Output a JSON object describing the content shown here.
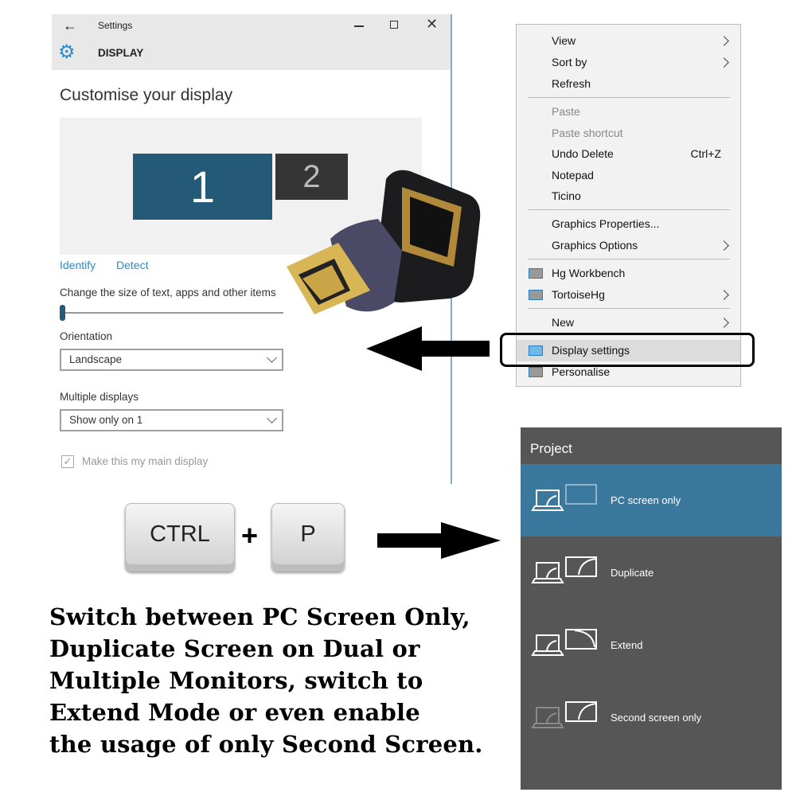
{
  "settings": {
    "window_title": "Settings",
    "section": "DISPLAY",
    "page_title": "Customise your display",
    "monitors": [
      "1",
      "2"
    ],
    "identify": "Identify",
    "detect": "Detect",
    "scale_label": "Change the size of text, apps and other items",
    "scale_value": 0,
    "orientation_label": "Orientation",
    "orientation_value": "Landscape",
    "multiple_label": "Multiple displays",
    "multiple_value": "Show only on 1",
    "main_display_label": "Make this my main display",
    "main_display_checked": true,
    "accent": "#245a78"
  },
  "context_menu": {
    "items": [
      {
        "label": "View",
        "submenu": true
      },
      {
        "label": "Sort by",
        "submenu": true
      },
      {
        "label": "Refresh"
      },
      {
        "label": "Paste",
        "disabled": true
      },
      {
        "label": "Paste shortcut",
        "disabled": true
      },
      {
        "label": "Undo Delete",
        "shortcut": "Ctrl+Z"
      },
      {
        "label": "Notepad"
      },
      {
        "label": "Ticino"
      },
      {
        "label": "Graphics Properties..."
      },
      {
        "label": "Graphics Options",
        "submenu": true
      },
      {
        "label": "Hg Workbench",
        "icon": "hg-workbench-icon"
      },
      {
        "label": "TortoiseHg",
        "icon": "tortoisehg-icon",
        "submenu": true
      },
      {
        "label": "New",
        "submenu": true
      },
      {
        "label": "Display settings",
        "icon": "display-icon",
        "highlighted": true
      },
      {
        "label": "Personalise",
        "icon": "personalise-icon"
      }
    ]
  },
  "keys": {
    "ctrl": "CTRL",
    "plus": "+",
    "p": "P"
  },
  "project": {
    "title": "Project",
    "items": [
      {
        "label": "PC screen only",
        "selected": true
      },
      {
        "label": "Duplicate"
      },
      {
        "label": "Extend"
      },
      {
        "label": "Second screen only"
      }
    ],
    "accent": "#3a789e"
  },
  "caption": [
    "Switch between PC Screen Only,",
    "Duplicate Screen on Dual or",
    "Multiple Monitors, switch to",
    "Extend Mode or even enable",
    "the usage of only Second Screen."
  ]
}
